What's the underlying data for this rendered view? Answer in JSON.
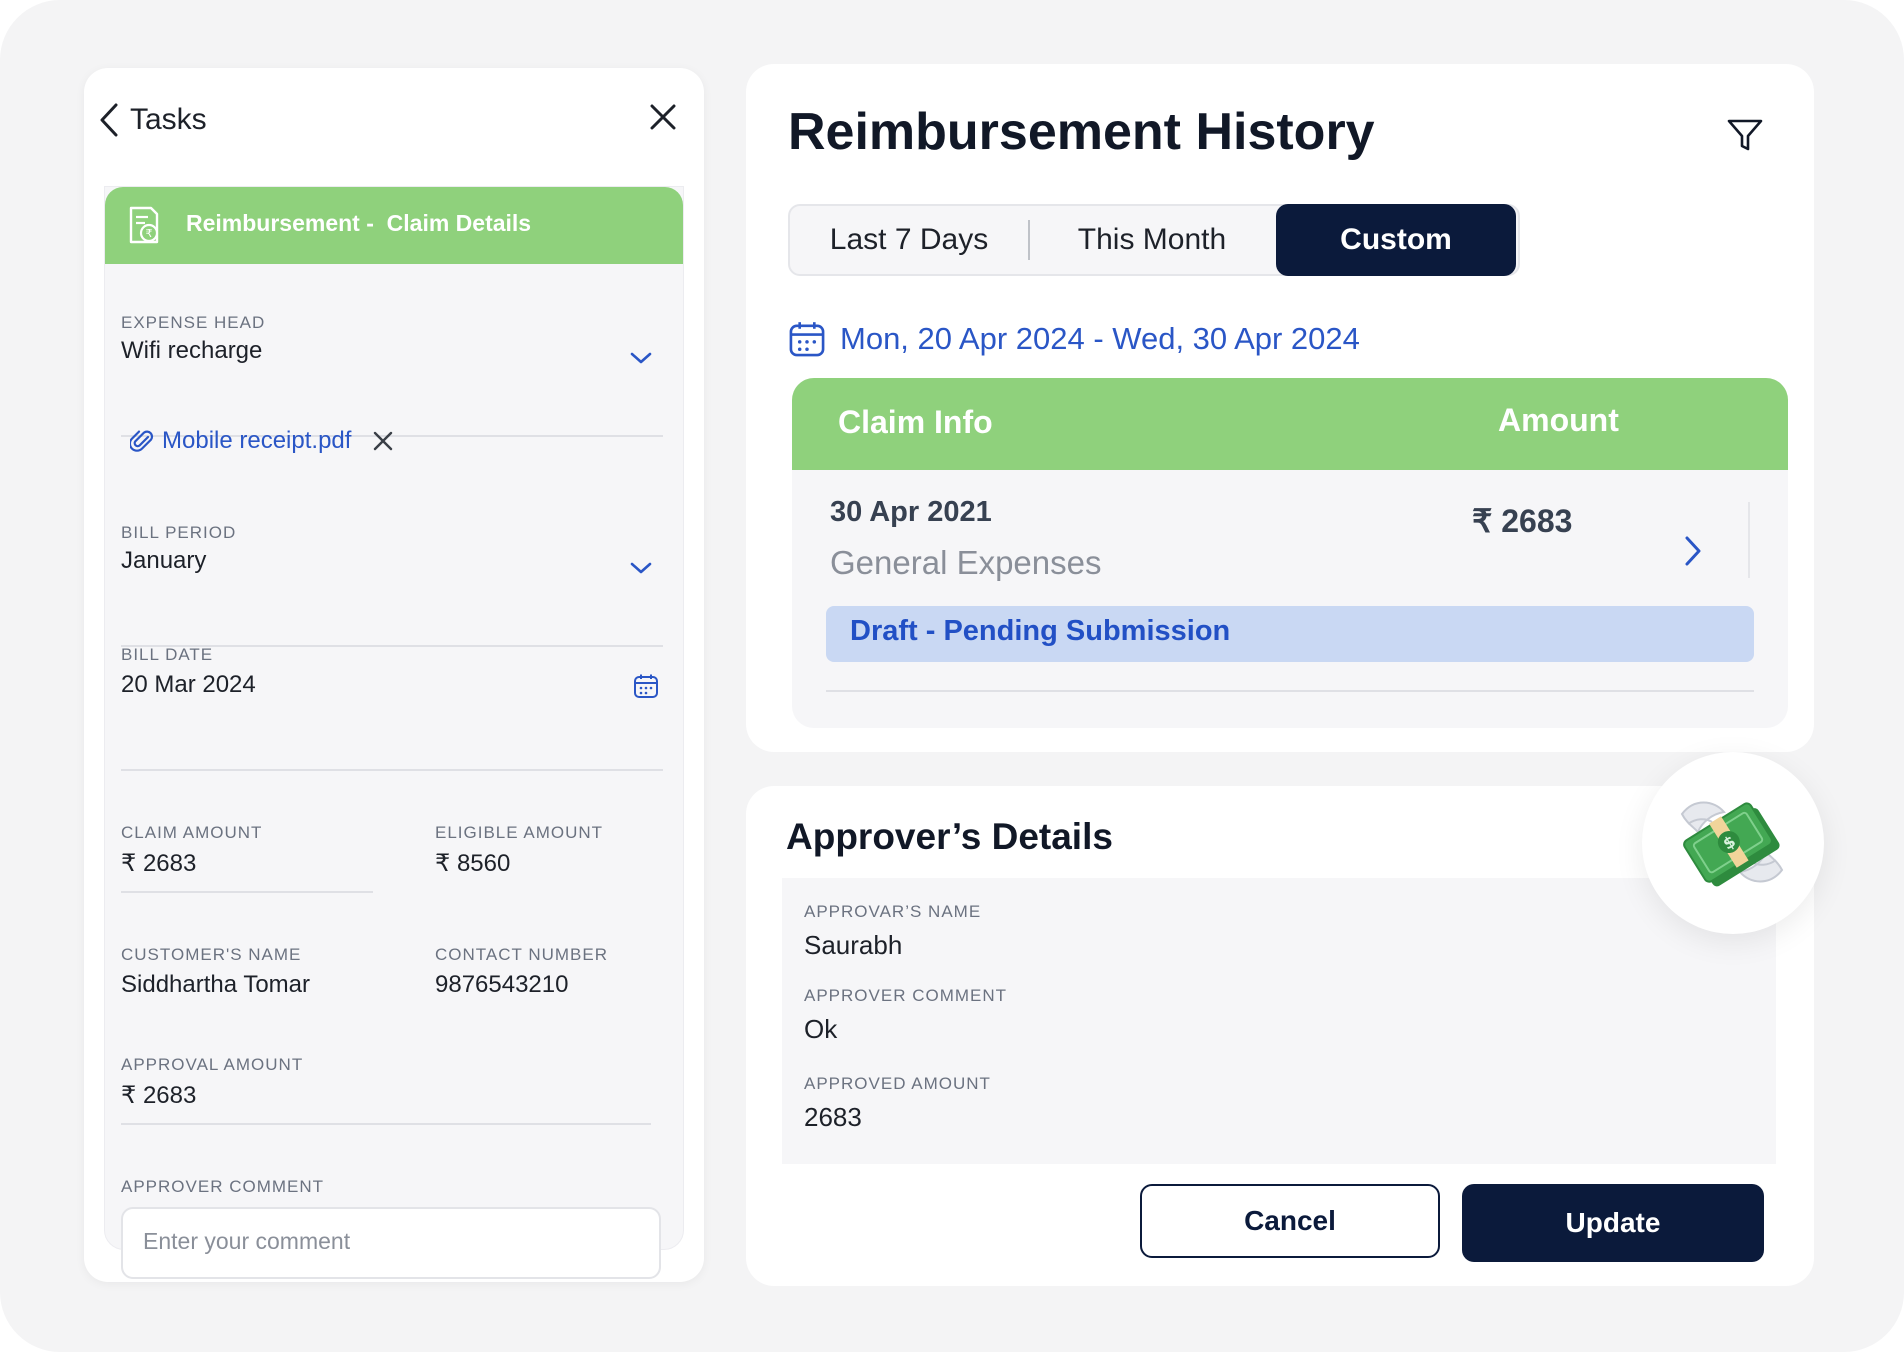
{
  "tasks": {
    "back_label": "Tasks",
    "banner_title": "Reimbursement -  Claim Details",
    "expense_head": {
      "label": "EXPENSE HEAD",
      "value": "Wifi recharge"
    },
    "attachment": {
      "file_name": "Mobile receipt.pdf"
    },
    "bill_period": {
      "label": "BILL PERIOD",
      "value": "January"
    },
    "bill_date": {
      "label": "BILL DATE",
      "value": "20 Mar 2024"
    },
    "claim_amount": {
      "label": "CLAIM AMOUNT",
      "value": "₹ 2683"
    },
    "eligible_amount": {
      "label": "ELIGIBLE AMOUNT",
      "value": "₹ 8560"
    },
    "customer_name": {
      "label": "CUSTOMER'S NAME",
      "value": "Siddhartha Tomar"
    },
    "contact_number": {
      "label": "CONTACT NUMBER",
      "value": "9876543210"
    },
    "approval_amount": {
      "label": "APPROVAL AMOUNT",
      "value": "₹ 2683"
    },
    "approver_comment": {
      "label": "APPROVER COMMENT",
      "placeholder": "Enter your comment",
      "value": ""
    }
  },
  "history": {
    "title": "Reimbursement History",
    "tabs": [
      {
        "label": "Last 7 Days",
        "active": false
      },
      {
        "label": "This Month",
        "active": false
      },
      {
        "label": "Custom",
        "active": true
      }
    ],
    "date_range": "Mon, 20 Apr 2024 - Wed, 30 Apr 2024",
    "table": {
      "headers": {
        "claim_info": "Claim Info",
        "amount": "Amount"
      },
      "rows": [
        {
          "date": "30 Apr 2021",
          "category": "General Expenses",
          "amount": "₹ 2683",
          "status": "Draft - Pending Submission"
        }
      ]
    }
  },
  "approver": {
    "title": "Approver’s Details",
    "name": {
      "label": "APPROVAR’S NAME",
      "value": "Saurabh"
    },
    "comment": {
      "label": "APPROVER COMMENT",
      "value": "Ok"
    },
    "amount": {
      "label": "APPROVED AMOUNT",
      "value": "2683"
    },
    "cancel_label": "Cancel",
    "update_label": "Update"
  },
  "icons": [
    "back-chevron-icon",
    "close-icon",
    "document-rupee-icon",
    "chevron-down-icon",
    "paperclip-icon",
    "calendar-icon",
    "filter-icon",
    "chevron-right-icon",
    "money-with-wings-icon"
  ],
  "colors": {
    "accent_green": "#8fd17c",
    "navy": "#0b1a3b",
    "link_blue": "#2a56c6",
    "status_bg": "#c9d8f3"
  }
}
